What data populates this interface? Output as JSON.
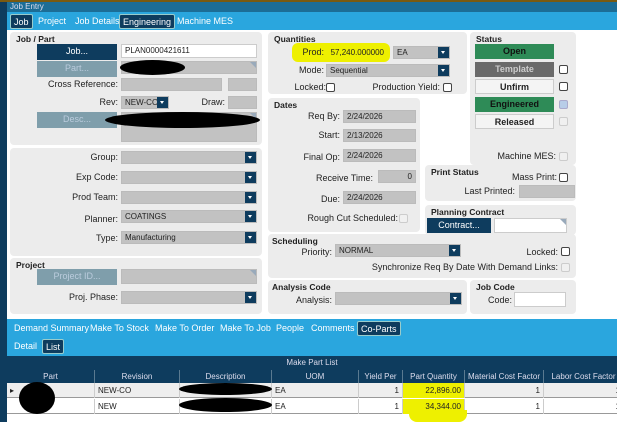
{
  "window": {
    "title": "Job Entry"
  },
  "tabs": [
    "Job",
    "Project",
    "Job Details",
    "Engineering",
    "Machine MES"
  ],
  "job_part": {
    "title": "Job / Part",
    "job_btn": "Job...",
    "job_value": "PLAN0000421611",
    "part_btn": "Part...",
    "cross_ref_label": "Cross Reference:",
    "rev_label": "Rev:",
    "rev_value": "NEW-CO",
    "draw_label": "Draw:",
    "desc_btn": "Desc..."
  },
  "details": {
    "group_label": "Group:",
    "exp_label": "Exp Code:",
    "team_label": "Prod Team:",
    "planner_label": "Planner:",
    "planner_value": "COATINGS",
    "type_label": "Type:",
    "type_value": "Manufacturing"
  },
  "project": {
    "title": "Project",
    "id_btn": "Project ID...",
    "phase_label": "Proj. Phase:"
  },
  "quantities": {
    "title": "Quantities",
    "prod_label": "Prod:",
    "prod_value": "57,240.000000",
    "uom": "EA",
    "mode_label": "Mode:",
    "mode_value": "Sequential",
    "locked_label": "Locked:",
    "yield_label": "Production Yield:"
  },
  "dates": {
    "title": "Dates",
    "reqby_label": "Req By:",
    "reqby": "2/24/2026",
    "start_label": "Start:",
    "start": "2/13/2026",
    "finalop_label": "Final Op:",
    "finalop": "2/24/2026",
    "receive_label": "Receive Time:",
    "receive": "0",
    "due_label": "Due:",
    "due": "2/24/2026",
    "roughcut_label": "Rough Cut Scheduled:"
  },
  "status": {
    "title": "Status",
    "open": "Open",
    "template": "Template",
    "unfirm": "Unfirm",
    "engineered": "Engineered",
    "released": "Released",
    "mes_label": "Machine MES:"
  },
  "print_status": {
    "title": "Print Status",
    "mass_label": "Mass Print:",
    "last_label": "Last Printed:"
  },
  "planning": {
    "title": "Planning Contract",
    "btn": "Contract..."
  },
  "scheduling": {
    "title": "Scheduling",
    "priority_label": "Priority:",
    "priority": "NORMAL",
    "locked_label": "Locked:",
    "sync_label": "Synchronize Req By Date With Demand Links:"
  },
  "analysis": {
    "title": "Analysis Code",
    "label": "Analysis:"
  },
  "jobcode": {
    "title": "Job Code",
    "label": "Code:"
  },
  "subtabs": [
    "Demand Summary",
    "Make To Stock",
    "Make To Order",
    "Make To Job",
    "People",
    "Comments",
    "Co-Parts"
  ],
  "viewtabs": [
    "Detail",
    "List"
  ],
  "grid": {
    "title": "Make Part List",
    "columns": [
      "Part",
      "Revision",
      "Description",
      "UOM",
      "Yield Per",
      "Part Quantity",
      "Material Cost Factor",
      "Labor Cost Factor"
    ],
    "rows": [
      {
        "revision": "NEW-CO",
        "uom": "EA",
        "yield": "1",
        "qty": "22,896.00",
        "mat": "1",
        "lab": "1"
      },
      {
        "revision": "NEW",
        "uom": "EA",
        "yield": "1",
        "qty": "34,344.00",
        "mat": "1",
        "lab": "1"
      }
    ]
  },
  "colors": {
    "accent": "#2aa6de",
    "dark": "#0e3c5e",
    "green": "#2e8b57",
    "highlight": "#eef000"
  }
}
